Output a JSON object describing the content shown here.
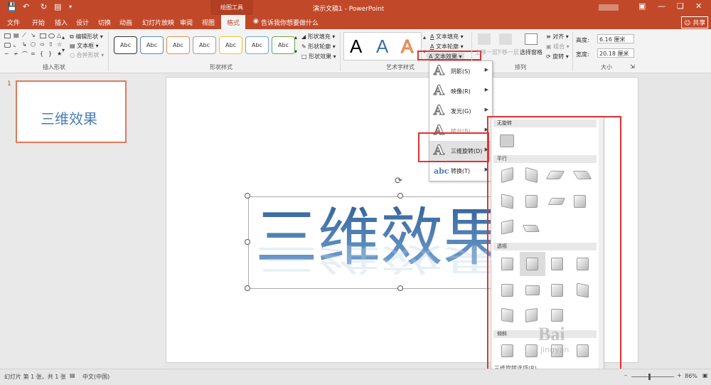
{
  "titlebar": {
    "context_tab": "绘图工具",
    "doc_title": "演示文稿1 - PowerPoint"
  },
  "tabs": [
    "文件",
    "开始",
    "插入",
    "设计",
    "切换",
    "动画",
    "幻灯片放映",
    "审阅",
    "视图",
    "格式"
  ],
  "active_tab": "格式",
  "tell_me": "告诉我你想要做什么",
  "share": "共享",
  "ribbon": {
    "insert_shapes": {
      "label": "插入形状",
      "edit_shape": "编辑形状",
      "text_box": "文本框",
      "merge_shapes": "合并形状"
    },
    "shape_styles": {
      "label": "形状样式",
      "sample": "Abc",
      "fill": "形状填充",
      "outline": "形状轮廓",
      "effects": "形状效果"
    },
    "wordart": {
      "label": "艺术字样式",
      "letter": "A",
      "text_fill": "文本填充",
      "text_outline": "文本轮廓",
      "text_effects": "文本效果"
    },
    "arrange": {
      "label": "排列",
      "forward": "上移一层",
      "backward": "下移一层",
      "selection_pane": "选择窗格",
      "align": "对齐",
      "group": "组合",
      "rotate": "旋转"
    },
    "size": {
      "label": "大小",
      "height_label": "高度:",
      "height": "6.16 厘米",
      "width_label": "宽度:",
      "width": "20.18 厘米"
    }
  },
  "thumb": {
    "number": "1",
    "text": "三维效果"
  },
  "slide": {
    "text": "三维效果"
  },
  "menu": {
    "items": [
      {
        "label": "阴影(S)",
        "icon": "A"
      },
      {
        "label": "映像(R)",
        "icon": "A"
      },
      {
        "label": "发光(G)",
        "icon": "A"
      },
      {
        "label": "棱台(B)",
        "icon": "A"
      },
      {
        "label": "三维旋转(D)",
        "icon": "A"
      },
      {
        "label": "转换(T)",
        "icon": "abc"
      }
    ]
  },
  "gallery": {
    "no_rotation": "无旋转",
    "parallel": "平行",
    "perspective": "透视",
    "oblique": "倾斜",
    "options": "三维旋转选项(R)..."
  },
  "status": {
    "slide_info": "幻灯片 第 1 张，共 1 张",
    "language": "中文(中国)",
    "zoom": "86%"
  },
  "watermark": {
    "line1": "Bai",
    "line2": "jingyan"
  },
  "colors": {
    "accent": "#c1492a",
    "highlight": "#e53030"
  }
}
